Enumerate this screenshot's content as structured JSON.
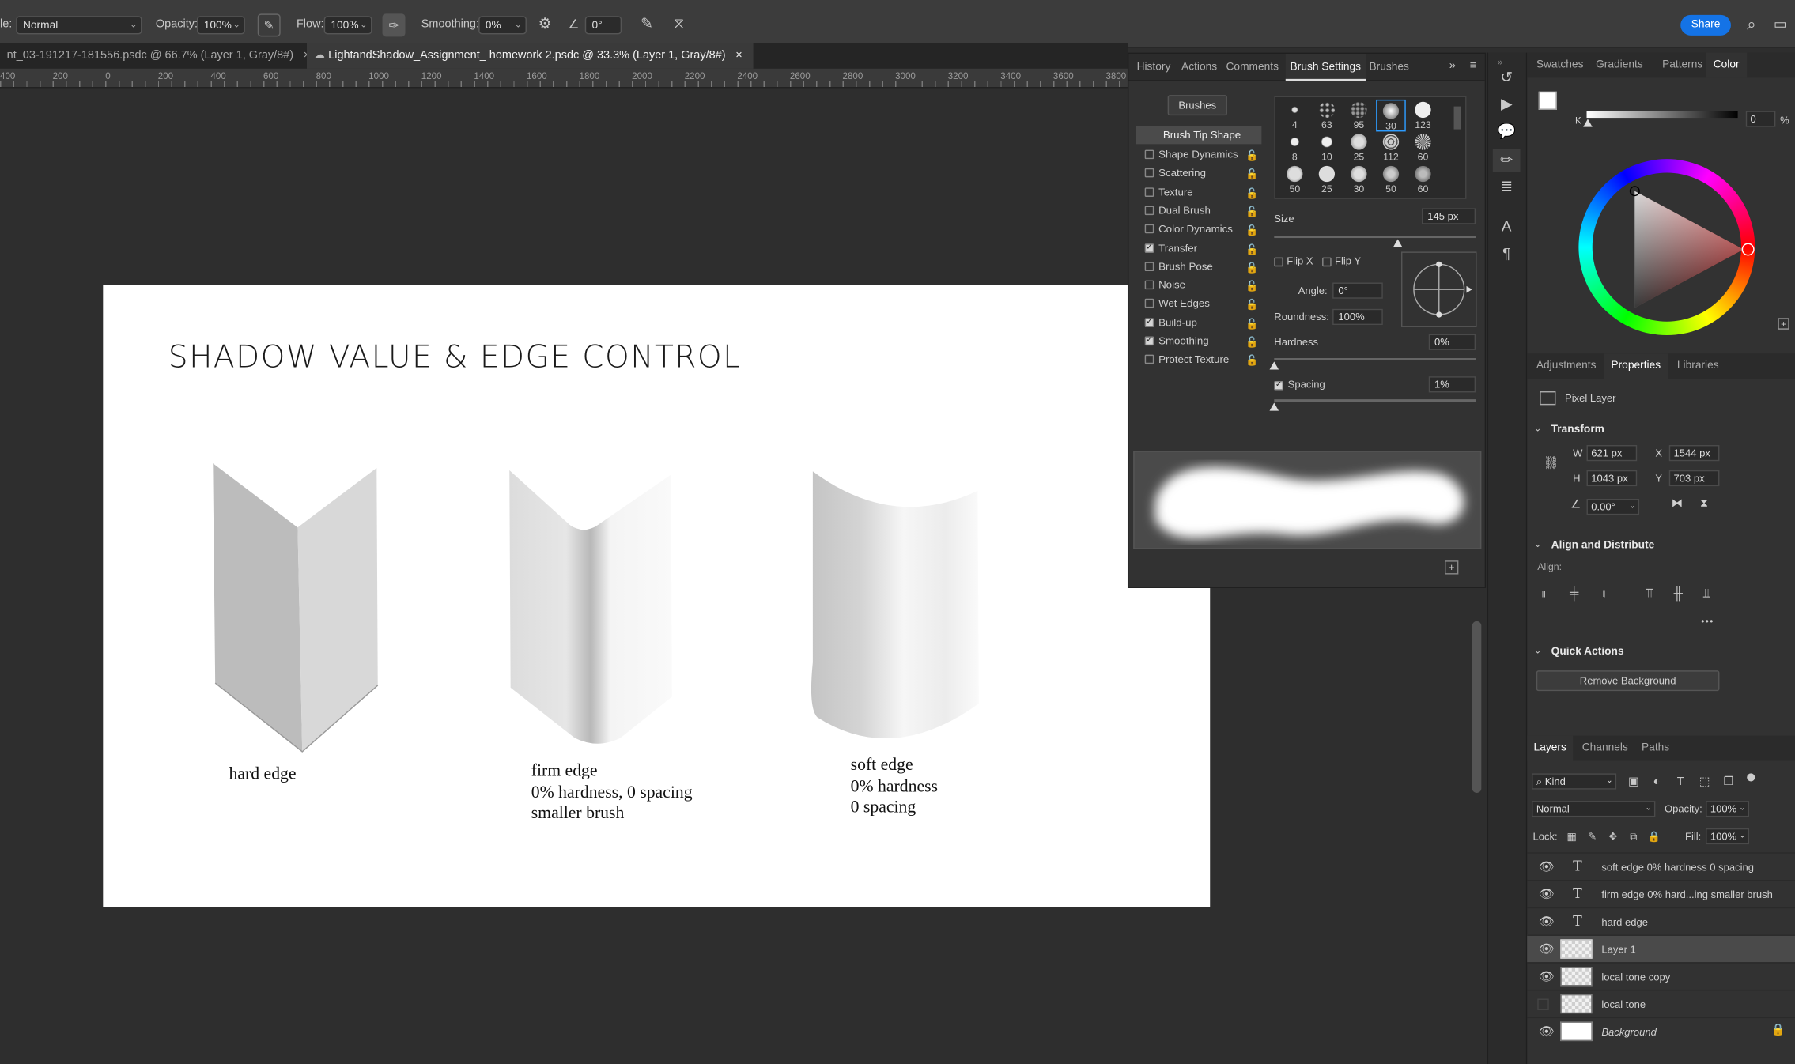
{
  "options_bar": {
    "mode_label_prefix": "le:",
    "mode_value": "Normal",
    "opacity_label": "Opacity:",
    "opacity_value": "100%",
    "flow_label": "Flow:",
    "flow_value": "100%",
    "smoothing_label": "Smoothing:",
    "smoothing_value": "0%",
    "angle_value": "0°",
    "share_label": "Share"
  },
  "doc_tabs": [
    {
      "label": "nt_03-191217-181556.psdc @ 66.7% (Layer 1, Gray/8#)",
      "close": "×"
    },
    {
      "label": "LightandShadow_Assignment_ homework 2.psdc @ 33.3% (Layer 1, Gray/8#)",
      "close": "×"
    }
  ],
  "ruler": [
    "400",
    "200",
    "0",
    "200",
    "400",
    "600",
    "800",
    "1000",
    "1200",
    "1400",
    "1600",
    "1800",
    "2000",
    "2200",
    "2400",
    "2600",
    "2800",
    "3000",
    "3200",
    "3400",
    "3600",
    "3800"
  ],
  "canvas": {
    "title": "SHADOW VALUE & EDGE CONTROL",
    "captions": [
      {
        "lines": [
          "hard edge"
        ]
      },
      {
        "lines": [
          "firm edge",
          "0% hardness, 0 spacing",
          "smaller brush"
        ]
      },
      {
        "lines": [
          "soft edge",
          "0% hardness",
          "0 spacing"
        ]
      }
    ]
  },
  "brush_panel": {
    "tabs": [
      "History",
      "Actions",
      "Comments",
      "Brush Settings",
      "Brushes"
    ],
    "active_tab": "Brush Settings",
    "brushes_button": "Brushes",
    "tip_shape_label": "Brush Tip Shape",
    "settings": [
      {
        "label": "Shape Dynamics",
        "checked": false
      },
      {
        "label": "Scattering",
        "checked": false
      },
      {
        "label": "Texture",
        "checked": false
      },
      {
        "label": "Dual Brush",
        "checked": false
      },
      {
        "label": "Color Dynamics",
        "checked": false
      },
      {
        "label": "Transfer",
        "checked": true
      },
      {
        "label": "Brush Pose",
        "checked": false
      },
      {
        "label": "Noise",
        "checked": false
      },
      {
        "label": "Wet Edges",
        "checked": false
      },
      {
        "label": "Build-up",
        "checked": true
      },
      {
        "label": "Smoothing",
        "checked": true
      },
      {
        "label": "Protect Texture",
        "checked": false
      }
    ],
    "tips": [
      [
        "4",
        "63",
        "95",
        "30",
        "123"
      ],
      [
        "8",
        "10",
        "25",
        "112",
        "60"
      ],
      [
        "50",
        "25",
        "30",
        "50",
        "60"
      ]
    ],
    "size_label": "Size",
    "size_value": "145 px",
    "flip_x": "Flip X",
    "flip_y": "Flip Y",
    "angle_label": "Angle:",
    "angle_value": "0°",
    "roundness_label": "Roundness:",
    "roundness_value": "100%",
    "hardness_label": "Hardness",
    "hardness_value": "0%",
    "spacing_label": "Spacing",
    "spacing_value": "1%"
  },
  "color_panel": {
    "tabs": [
      "Swatches",
      "Gradients",
      "Patterns",
      "Color"
    ],
    "active_tab": "Color",
    "k_label": "K",
    "k_value": "0",
    "k_unit": "%"
  },
  "properties_panel": {
    "tabs": [
      "Adjustments",
      "Properties",
      "Libraries"
    ],
    "active_tab": "Properties",
    "layer_kind": "Pixel Layer",
    "transform_title": "Transform",
    "w_label": "W",
    "w_value": "621 px",
    "x_label": "X",
    "x_value": "1544 px",
    "h_label": "H",
    "h_value": "1043 px",
    "y_label": "Y",
    "y_value": "703 px",
    "rotation_value": "0.00°",
    "align_title": "Align and Distribute",
    "align_label": "Align:",
    "more": "•••",
    "quick_title": "Quick Actions",
    "remove_bg": "Remove Background"
  },
  "layers_panel": {
    "tabs": [
      "Layers",
      "Channels",
      "Paths"
    ],
    "active_tab": "Layers",
    "kind_label": "Kind",
    "blend_mode": "Normal",
    "opacity_label": "Opacity:",
    "opacity_value": "100%",
    "lock_label": "Lock:",
    "fill_label": "Fill:",
    "fill_value": "100%",
    "layers": [
      {
        "name": "soft edge 0% hardness 0 spacing",
        "type": "text",
        "visible": true
      },
      {
        "name": "firm edge 0% hard...ing smaller brush",
        "type": "text",
        "visible": true
      },
      {
        "name": "hard edge",
        "type": "text",
        "visible": true
      },
      {
        "name": "Layer 1",
        "type": "pixel",
        "visible": true,
        "selected": true
      },
      {
        "name": "local tone copy",
        "type": "pixel",
        "visible": true
      },
      {
        "name": "local tone",
        "type": "pixel",
        "visible": false
      },
      {
        "name": "Background",
        "type": "background",
        "visible": true,
        "locked": true
      }
    ]
  }
}
